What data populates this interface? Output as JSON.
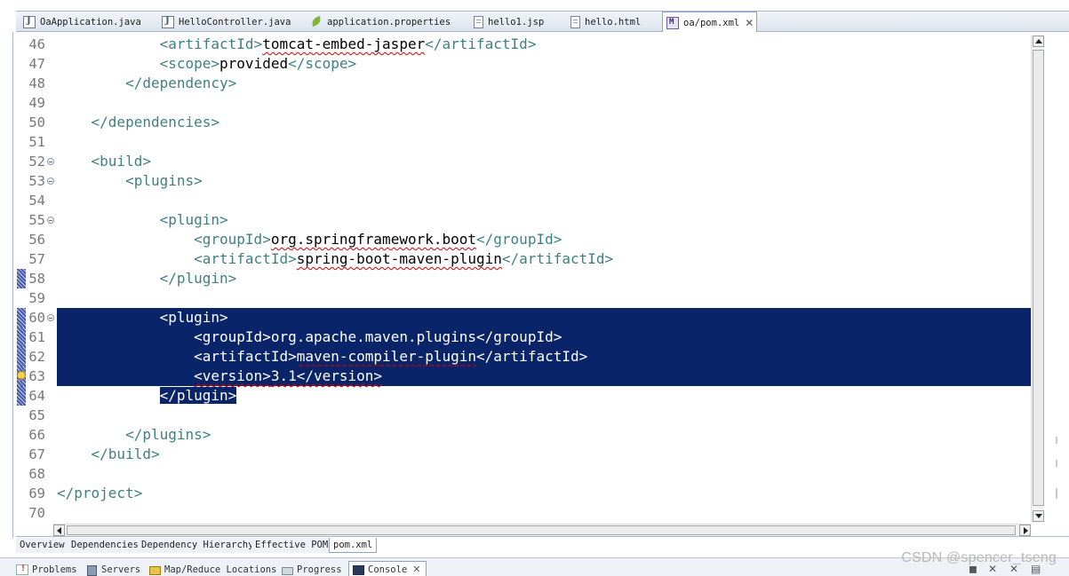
{
  "editor_tabs": [
    {
      "label": "OaApplication.java",
      "icon": "java-file-icon"
    },
    {
      "label": "HelloController.java",
      "icon": "java-file-icon"
    },
    {
      "label": "application.properties",
      "icon": "spring-leaf-icon"
    },
    {
      "label": "hello1.jsp",
      "icon": "jsp-file-icon"
    },
    {
      "label": "hello.html",
      "icon": "html-file-icon"
    },
    {
      "label": "oa/pom.xml",
      "icon": "maven-pom-icon",
      "active": true,
      "close": "✕"
    }
  ],
  "code_lines": [
    {
      "num": "46",
      "indent": "            ",
      "open": "<artifactId>",
      "text": "tomcat-embed-jasper",
      "close": "</artifactId>"
    },
    {
      "num": "47",
      "indent": "            ",
      "open": "<scope>",
      "text": "provided",
      "close": "</scope>"
    },
    {
      "num": "48",
      "indent": "        ",
      "open": "</dependency>",
      "text": "",
      "close": ""
    },
    {
      "num": "49",
      "indent": "",
      "open": "",
      "text": "",
      "close": ""
    },
    {
      "num": "50",
      "indent": "    ",
      "open": "</dependencies>",
      "text": "",
      "close": ""
    },
    {
      "num": "51",
      "indent": "",
      "open": "",
      "text": "",
      "close": ""
    },
    {
      "num": "52",
      "indent": "    ",
      "open": "<build>",
      "text": "",
      "close": ""
    },
    {
      "num": "53",
      "indent": "        ",
      "open": "<plugins>",
      "text": "",
      "close": ""
    },
    {
      "num": "54",
      "indent": "",
      "open": "",
      "text": "",
      "close": ""
    },
    {
      "num": "55",
      "indent": "            ",
      "open": "<plugin>",
      "text": "",
      "close": ""
    },
    {
      "num": "56",
      "indent": "                ",
      "open": "<groupId>",
      "text": "org.springframework.boot",
      "close": "</groupId>"
    },
    {
      "num": "57",
      "indent": "                ",
      "open": "<artifactId>",
      "text": "spring-boot-maven-plugin",
      "close": "</artifactId>"
    },
    {
      "num": "58",
      "indent": "            ",
      "open": "</plugin>",
      "text": "",
      "close": ""
    },
    {
      "num": "59",
      "indent": "",
      "open": "",
      "text": "",
      "close": ""
    },
    {
      "num": "60",
      "indent": "            ",
      "open": "<plugin>",
      "text": "",
      "close": ""
    },
    {
      "num": "61",
      "indent": "                ",
      "open": "<groupId>",
      "text": "org.apache.maven.plugins",
      "close": "</groupId>"
    },
    {
      "num": "62",
      "indent": "                ",
      "open": "<artifactId>",
      "text": "maven-compiler-plugin",
      "close": "</artifactId>"
    },
    {
      "num": "63",
      "indent": "                ",
      "open": "<version>",
      "text": "3.1",
      "close": "</version>"
    },
    {
      "num": "64",
      "indent": "            ",
      "open": "</plugin>",
      "text": "",
      "close": ""
    },
    {
      "num": "65",
      "indent": "",
      "open": "",
      "text": "",
      "close": ""
    },
    {
      "num": "66",
      "indent": "        ",
      "open": "</plugins>",
      "text": "",
      "close": ""
    },
    {
      "num": "67",
      "indent": "    ",
      "open": "</build>",
      "text": "",
      "close": ""
    },
    {
      "num": "68",
      "indent": "",
      "open": "",
      "text": "",
      "close": ""
    },
    {
      "num": "69",
      "indent": "",
      "open": "</project>",
      "text": "",
      "close": ""
    },
    {
      "num": "70",
      "indent": "",
      "open": "",
      "text": "",
      "close": ""
    }
  ],
  "fold_lines": [
    "52",
    "53",
    "55",
    "60"
  ],
  "changed_lines": [
    "58",
    "60",
    "61",
    "62",
    "63",
    "64"
  ],
  "warning_lines": [
    "63"
  ],
  "selected_lines": [
    "60",
    "61",
    "62",
    "63",
    "64"
  ],
  "squiggle_lines": [
    "46",
    "56",
    "57",
    "62",
    "63"
  ],
  "pom_tabs": [
    {
      "label": "Overview"
    },
    {
      "label": "Dependencies"
    },
    {
      "label": "Dependency Hierarchy"
    },
    {
      "label": "Effective POM"
    },
    {
      "label": "pom.xml",
      "active": true
    }
  ],
  "view_tabs": [
    {
      "label": "Problems",
      "icon": "problems-icon"
    },
    {
      "label": "Servers",
      "icon": "servers-icon"
    },
    {
      "label": "Map/Reduce Locations",
      "icon": "map-reduce-icon"
    },
    {
      "label": "Progress",
      "icon": "progress-icon"
    },
    {
      "label": "Console",
      "icon": "console-icon",
      "active": true,
      "close": "✕"
    }
  ],
  "watermark": "CSDN @spencer_tseng",
  "colors": {
    "selection": "#0a246a",
    "tag": "#3f7f7f",
    "line_number": "#787878"
  }
}
